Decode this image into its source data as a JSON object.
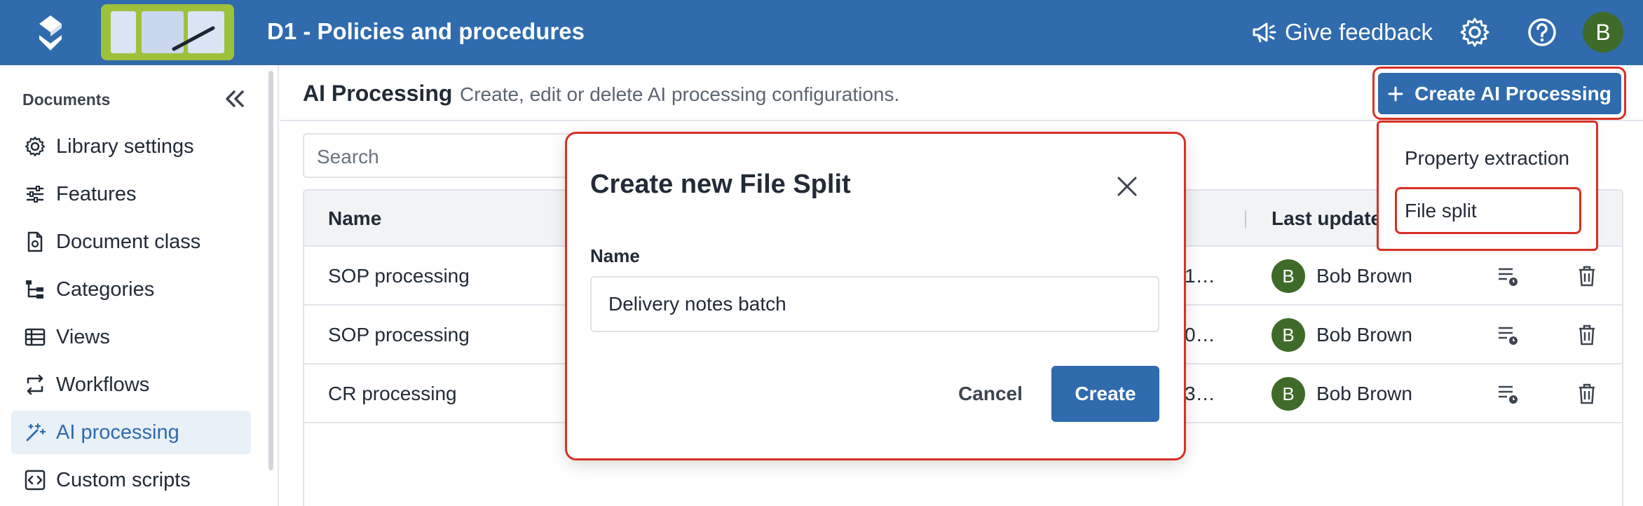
{
  "header": {
    "app_title": "D1 - Policies and procedures",
    "feedback_label": "Give feedback",
    "user_initial": "B",
    "brand_color": "#2f6bad"
  },
  "sidebar": {
    "heading": "Documents",
    "items": [
      {
        "label": "Library settings",
        "icon": "gear-icon"
      },
      {
        "label": "Features",
        "icon": "sliders-icon"
      },
      {
        "label": "Document class",
        "icon": "document-gear-icon"
      },
      {
        "label": "Categories",
        "icon": "hierarchy-icon"
      },
      {
        "label": "Views",
        "icon": "table-view-icon"
      },
      {
        "label": "Workflows",
        "icon": "workflow-arrows-icon"
      },
      {
        "label": "AI processing",
        "icon": "sparkle-icon",
        "active": true
      },
      {
        "label": "Custom scripts",
        "icon": "code-icon"
      }
    ]
  },
  "main": {
    "title": "AI Processing",
    "subtitle": "Create, edit or delete AI processing configurations.",
    "create_button": "Create AI Processing",
    "search_placeholder": "Search",
    "dropdown": [
      "Property extraction",
      "File split"
    ],
    "table": {
      "columns": [
        "Name",
        "Last updated"
      ],
      "rows": [
        {
          "name": "SOP processing",
          "date_fragment": "1…",
          "user": "Bob Brown",
          "initial": "B"
        },
        {
          "name": "SOP processing",
          "date_fragment": "0…",
          "user": "Bob Brown",
          "initial": "B"
        },
        {
          "name": "CR processing",
          "date_fragment": "3…",
          "user": "Bob Brown",
          "initial": "B"
        }
      ]
    }
  },
  "dialog": {
    "title": "Create new File Split",
    "name_label": "Name",
    "name_value": "Delivery notes batch",
    "cancel_label": "Cancel",
    "create_label": "Create"
  },
  "colors": {
    "accent": "#2f6bad",
    "highlight": "#d93025",
    "avatar": "#3f6b2a"
  }
}
